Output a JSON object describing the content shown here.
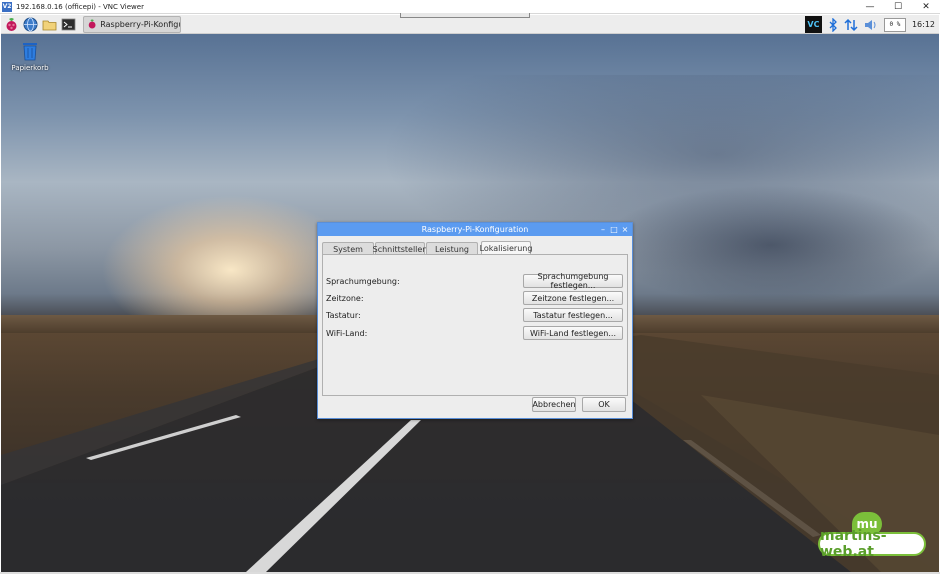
{
  "window": {
    "logo_text": "V2",
    "title": "192.168.0.16 (officepi) - VNC Viewer",
    "controls": {
      "minimize": "—",
      "maximize": "☐",
      "close": "✕"
    }
  },
  "panel": {
    "launchers": [
      "raspberry-menu-icon",
      "web-browser-icon",
      "file-manager-icon",
      "terminal-icon"
    ],
    "task_button_label": "Raspberry-Pi-Konfigur...",
    "tray": {
      "vnc_icon": "VC",
      "bluetooth_icon": "bluetooth-icon",
      "network_icon": "network-updown-icon",
      "volume_icon": "volume-icon",
      "cpu": "0 %",
      "clock": "16:12"
    }
  },
  "desktop": {
    "trash_label": "Papierkorb"
  },
  "dialog": {
    "title": "Raspberry-Pi-Konfiguration",
    "controls": {
      "minimize": "–",
      "maximize": "□",
      "close": "×"
    },
    "tabs": [
      "System",
      "Schnittstellen",
      "Leistung",
      "Lokalisierung"
    ],
    "active_tab": "Lokalisierung",
    "rows": [
      {
        "label": "Sprachumgebung:",
        "button": "Sprachumgebung festlegen..."
      },
      {
        "label": "Zeitzone:",
        "button": "Zeitzone festlegen..."
      },
      {
        "label": "Tastatur:",
        "button": "Tastatur festlegen..."
      },
      {
        "label": "WiFi-Land:",
        "button": "WiFi-Land festlegen..."
      }
    ],
    "cancel_label": "Abbrechen",
    "ok_label": "OK"
  },
  "watermark": {
    "badge": "mu",
    "text": "martins-web.at"
  },
  "colors": {
    "dialog_titlebar": "#5b9bf0",
    "watermark_green": "#7bbf3a"
  }
}
